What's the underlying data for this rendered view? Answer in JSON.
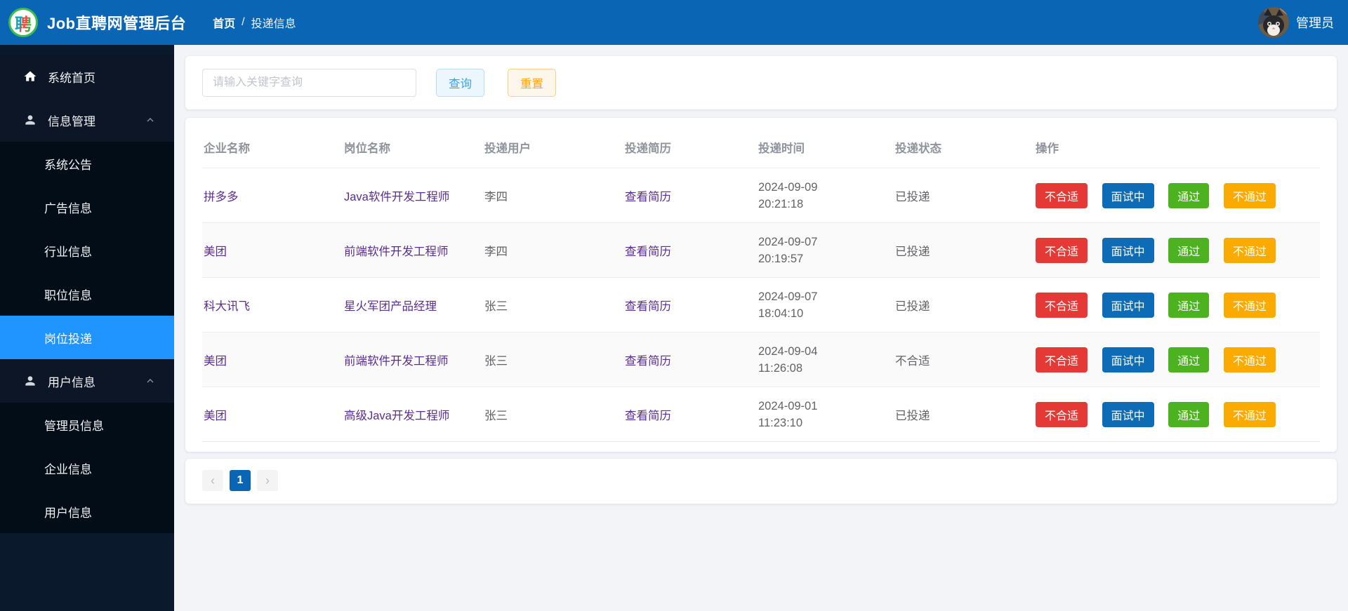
{
  "header": {
    "logo_char": "聘",
    "title": "Job直聘网管理后台",
    "breadcrumb": {
      "home": "首页",
      "separator": "/",
      "current": "投递信息"
    },
    "user": "管理员"
  },
  "sidebar": {
    "home": "系统首页",
    "info_group": "信息管理",
    "info_children": [
      "系统公告",
      "广告信息",
      "行业信息",
      "职位信息",
      "岗位投递"
    ],
    "active_item": "岗位投递",
    "user_group": "用户信息",
    "user_children": [
      "管理员信息",
      "企业信息",
      "用户信息"
    ]
  },
  "search": {
    "placeholder": "请输入关键字查询",
    "query_label": "查询",
    "reset_label": "重置"
  },
  "table": {
    "headers": [
      "企业名称",
      "岗位名称",
      "投递用户",
      "投递简历",
      "投递时间",
      "投递状态",
      "操作"
    ],
    "resume_link": "查看简历",
    "actions": [
      "不合适",
      "面试中",
      "通过",
      "不通过"
    ],
    "rows": [
      {
        "company": "拼多多",
        "job": "Java软件开发工程师",
        "user": "李四",
        "date": "2024-09-09",
        "time": "20:21:18",
        "status": "已投递"
      },
      {
        "company": "美团",
        "job": "前端软件开发工程师",
        "user": "李四",
        "date": "2024-09-07",
        "time": "20:19:57",
        "status": "已投递"
      },
      {
        "company": "科大讯飞",
        "job": "星火军团产品经理",
        "user": "张三",
        "date": "2024-09-07",
        "time": "18:04:10",
        "status": "已投递"
      },
      {
        "company": "美团",
        "job": "前端软件开发工程师",
        "user": "张三",
        "date": "2024-09-04",
        "time": "11:26:08",
        "status": "不合适"
      },
      {
        "company": "美团",
        "job": "高级Java开发工程师",
        "user": "张三",
        "date": "2024-09-01",
        "time": "11:23:10",
        "status": "已投递"
      }
    ]
  },
  "pagination": {
    "prev": "‹",
    "page": "1",
    "next": "›"
  },
  "colors": {
    "header_blue": "#0a66b5",
    "sidebar_active_blue": "#2094ff",
    "action_red": "#e53935",
    "action_blue": "#0e6bb6",
    "action_green": "#4cb220",
    "action_orange": "#fbab00",
    "link_purple": "#5b2d90"
  }
}
